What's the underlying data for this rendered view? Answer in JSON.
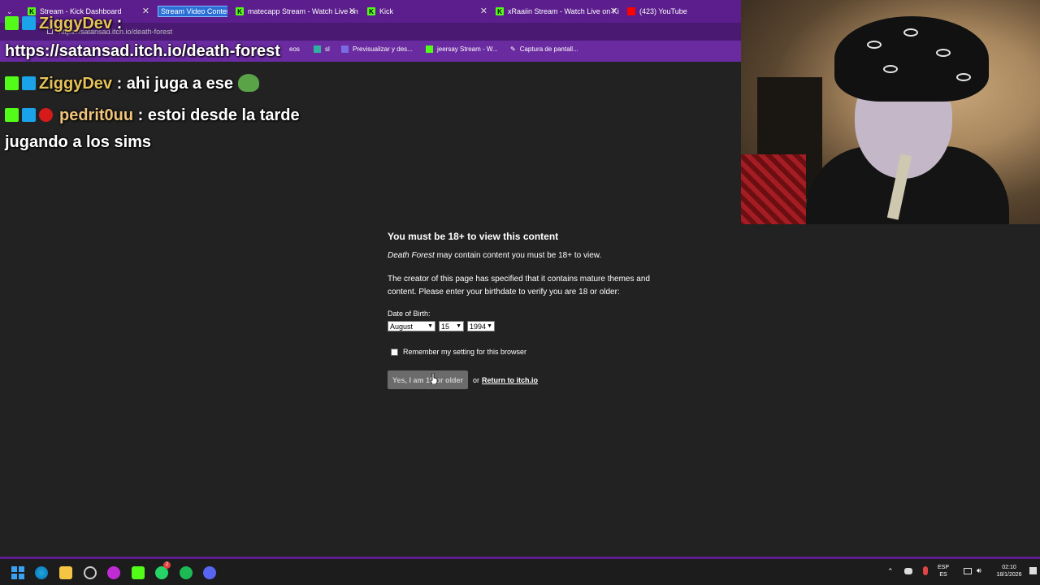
{
  "tabs": [
    {
      "label": "Stream - Kick Dashboard"
    },
    {
      "label": "Stream Video Content"
    },
    {
      "label": "matecapp Stream - Watch Live on"
    },
    {
      "label": "Kick"
    },
    {
      "label": "xRaaiin Stream - Watch Live on Ki"
    },
    {
      "label": "(423) YouTube"
    }
  ],
  "address": {
    "url": "https://satansad.itch.io/death-forest"
  },
  "bookmarks": [
    {
      "label": "eos"
    },
    {
      "label": "sl"
    },
    {
      "label": "Previsualizar y des..."
    },
    {
      "label": "jeersay Stream - W..."
    },
    {
      "label": "Captura de pantall..."
    }
  ],
  "chat": {
    "msg1_user": "ZiggyDev",
    "msg1_sep": " :",
    "url_text": "https://satansad.itch.io/death-forest",
    "msg2_user": "ZiggyDev",
    "msg2_text": " : ahi juga a ese",
    "msg3_user": "pedrit0uu",
    "msg3_text": " : estoi desde la tarde",
    "msg3_cont": "jugando a los sims"
  },
  "gate": {
    "title": "You must be 18+ to view this content",
    "game_name": "Death Forest",
    "line1_rest": " may contain content you must be 18+ to view.",
    "line2": "The creator of this page has specified that it contains mature themes and content. Please enter your birthdate to verify you are 18 or older:",
    "dob_label": "Date of Birth:",
    "month": "August",
    "day": "15",
    "year": "1994",
    "remember_label": "Remember my setting for this browser",
    "confirm_button": "Yes, I am 18 or older",
    "or_text": "or",
    "return_link": "Return to itch.io"
  },
  "taskbar": {
    "lang": "ESP",
    "lang_sub": "ES",
    "time": "02:10",
    "date": "18/1/2026",
    "whatsapp_badge": "2"
  },
  "colors": {
    "kick_green": "#53fc18",
    "chrome_purple": "#5b1e8c"
  }
}
